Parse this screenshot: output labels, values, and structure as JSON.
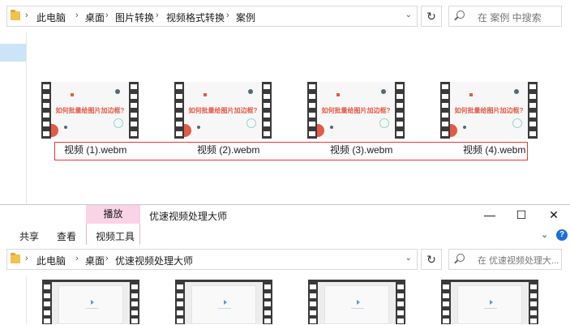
{
  "top_window": {
    "breadcrumb": [
      "此电脑",
      "桌面",
      "图片转换",
      "视频格式转换",
      "案例"
    ],
    "search_placeholder": "在 案例 中搜索",
    "files": [
      {
        "name": "视频 (1).webm",
        "thumb_text": "如何批量给图片加边框?"
      },
      {
        "name": "视频 (2).webm",
        "thumb_text": "如何批量给图片加边框?"
      },
      {
        "name": "视频 (3).webm",
        "thumb_text": "如何批量给图片加边框?"
      },
      {
        "name": "视频 (4).webm",
        "thumb_text": "如何批量给图片加边框?"
      }
    ]
  },
  "bottom_window": {
    "title": "优速视频处理大师",
    "context_tab": "播放",
    "ribbon_tabs": [
      "共享",
      "查看",
      "视频工具"
    ],
    "breadcrumb": [
      "此电脑",
      "桌面",
      "优速视频处理大师"
    ],
    "search_placeholder": "在 优速视频处理大..."
  },
  "icons": {
    "folder": "folder-icon",
    "refresh": "refresh-icon",
    "search": "search-icon",
    "minimize": "minimize-icon",
    "maximize": "maximize-icon",
    "close": "close-icon",
    "help": "help-icon"
  },
  "colors": {
    "highlight_border": "#e0393e",
    "context_tab": "#f9d3e6",
    "thumb_accent": "#e25b45",
    "nav_selected": "#cce4f7"
  }
}
